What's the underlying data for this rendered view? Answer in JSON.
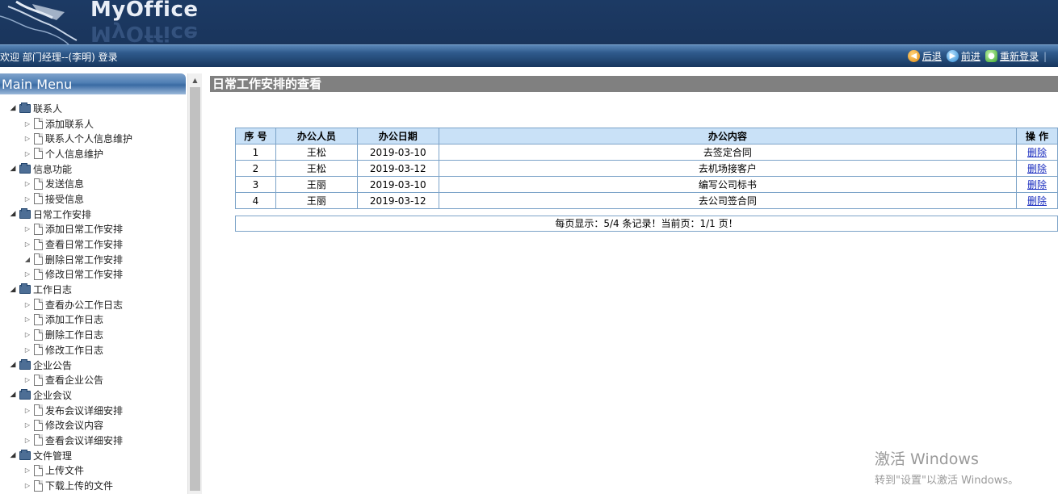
{
  "header": {
    "logo_text": "MyOffice",
    "logo_reflection": "MyOffice"
  },
  "topbar": {
    "welcome": "欢迎 部门经理--(李明) 登录",
    "back": "后退",
    "forward": "前进",
    "relogin": "重新登录",
    "separator": "|"
  },
  "sidebar": {
    "title": "Main Menu",
    "groups": [
      {
        "label": "联系人",
        "items": [
          "添加联系人",
          "联系人个人信息维护",
          "个人信息维护"
        ]
      },
      {
        "label": "信息功能",
        "items": [
          "发送信息",
          "接受信息"
        ]
      },
      {
        "label": "日常工作安排",
        "items": [
          "添加日常工作安排",
          "查看日常工作安排",
          "删除日常工作安排",
          "修改日常工作安排"
        ]
      },
      {
        "label": "工作日志",
        "items": [
          "查看办公工作日志",
          "添加工作日志",
          "删除工作日志",
          "修改工作日志"
        ]
      },
      {
        "label": "企业公告",
        "items": [
          "查看企业公告"
        ]
      },
      {
        "label": "企业会议",
        "items": [
          "发布会议详细安排",
          "修改会议内容",
          "查看会议详细安排"
        ]
      },
      {
        "label": "文件管理",
        "items": [
          "上传文件",
          "下载上传的文件"
        ]
      }
    ]
  },
  "main": {
    "title": "日常工作安排的查看",
    "table": {
      "headers": [
        "序 号",
        "办公人员",
        "办公日期",
        "办公内容",
        "操 作"
      ],
      "rows": [
        [
          "1",
          "王松",
          "2019-03-10",
          "去签定合同",
          "删除"
        ],
        [
          "2",
          "王松",
          "2019-03-12",
          "去机场接客户",
          "删除"
        ],
        [
          "3",
          "王丽",
          "2019-03-10",
          "编写公司标书",
          "删除"
        ],
        [
          "4",
          "王丽",
          "2019-03-12",
          "去公司签合同",
          "删除"
        ]
      ]
    },
    "pager": "每页显示：5/4 条记录！当前页：1/1 页！"
  },
  "watermark": {
    "line1": "激活 Windows",
    "line2": "转到\"设置\"以激活 Windows。"
  }
}
